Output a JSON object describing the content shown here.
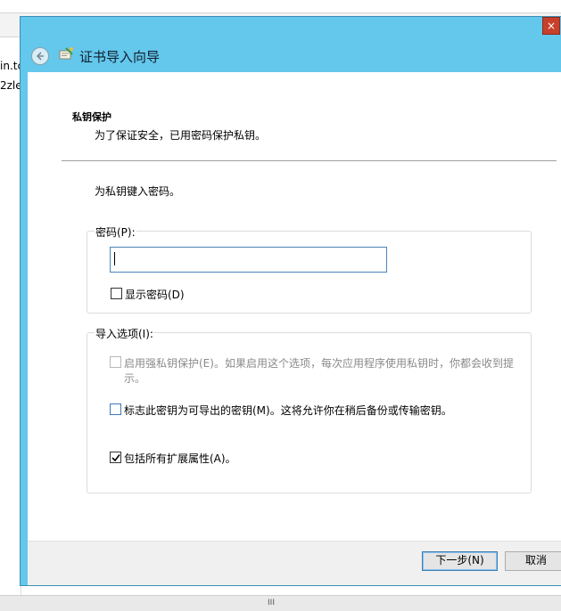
{
  "background": {
    "text_line1": "in.tc",
    "text_line2": "2zle",
    "scroll_grip": "III"
  },
  "dialog": {
    "title": "证书导入向导",
    "close_label": "×",
    "section_title": "私钥保护",
    "section_desc": "为了保证安全，已用密码保护私钥。",
    "instruction": "为私钥键入密码。",
    "password_group": {
      "legend": "密码(P):",
      "value": "",
      "show_password_label": "显示密码(D)",
      "show_password_checked": false
    },
    "options_group": {
      "legend": "导入选项(I):",
      "strong_protection_label_line1": "启用强私钥保护(E)。如果启用这个选项，每次应用程序使用私钥时，你都会收到提",
      "strong_protection_label_line2": "示。",
      "strong_protection_checked": false,
      "exportable_label": "标志此密钥为可导出的密钥(M)。这将允许你在稍后备份或传输密钥。",
      "exportable_checked": false,
      "include_extended_label": "包括所有扩展属性(A)。",
      "include_extended_checked": true
    },
    "buttons": {
      "next": "下一步(N)",
      "cancel": "取消"
    }
  },
  "colors": {
    "title_bar": "#64c7ec",
    "close_button": "#c7402b",
    "input_border": "#4a86b8"
  }
}
